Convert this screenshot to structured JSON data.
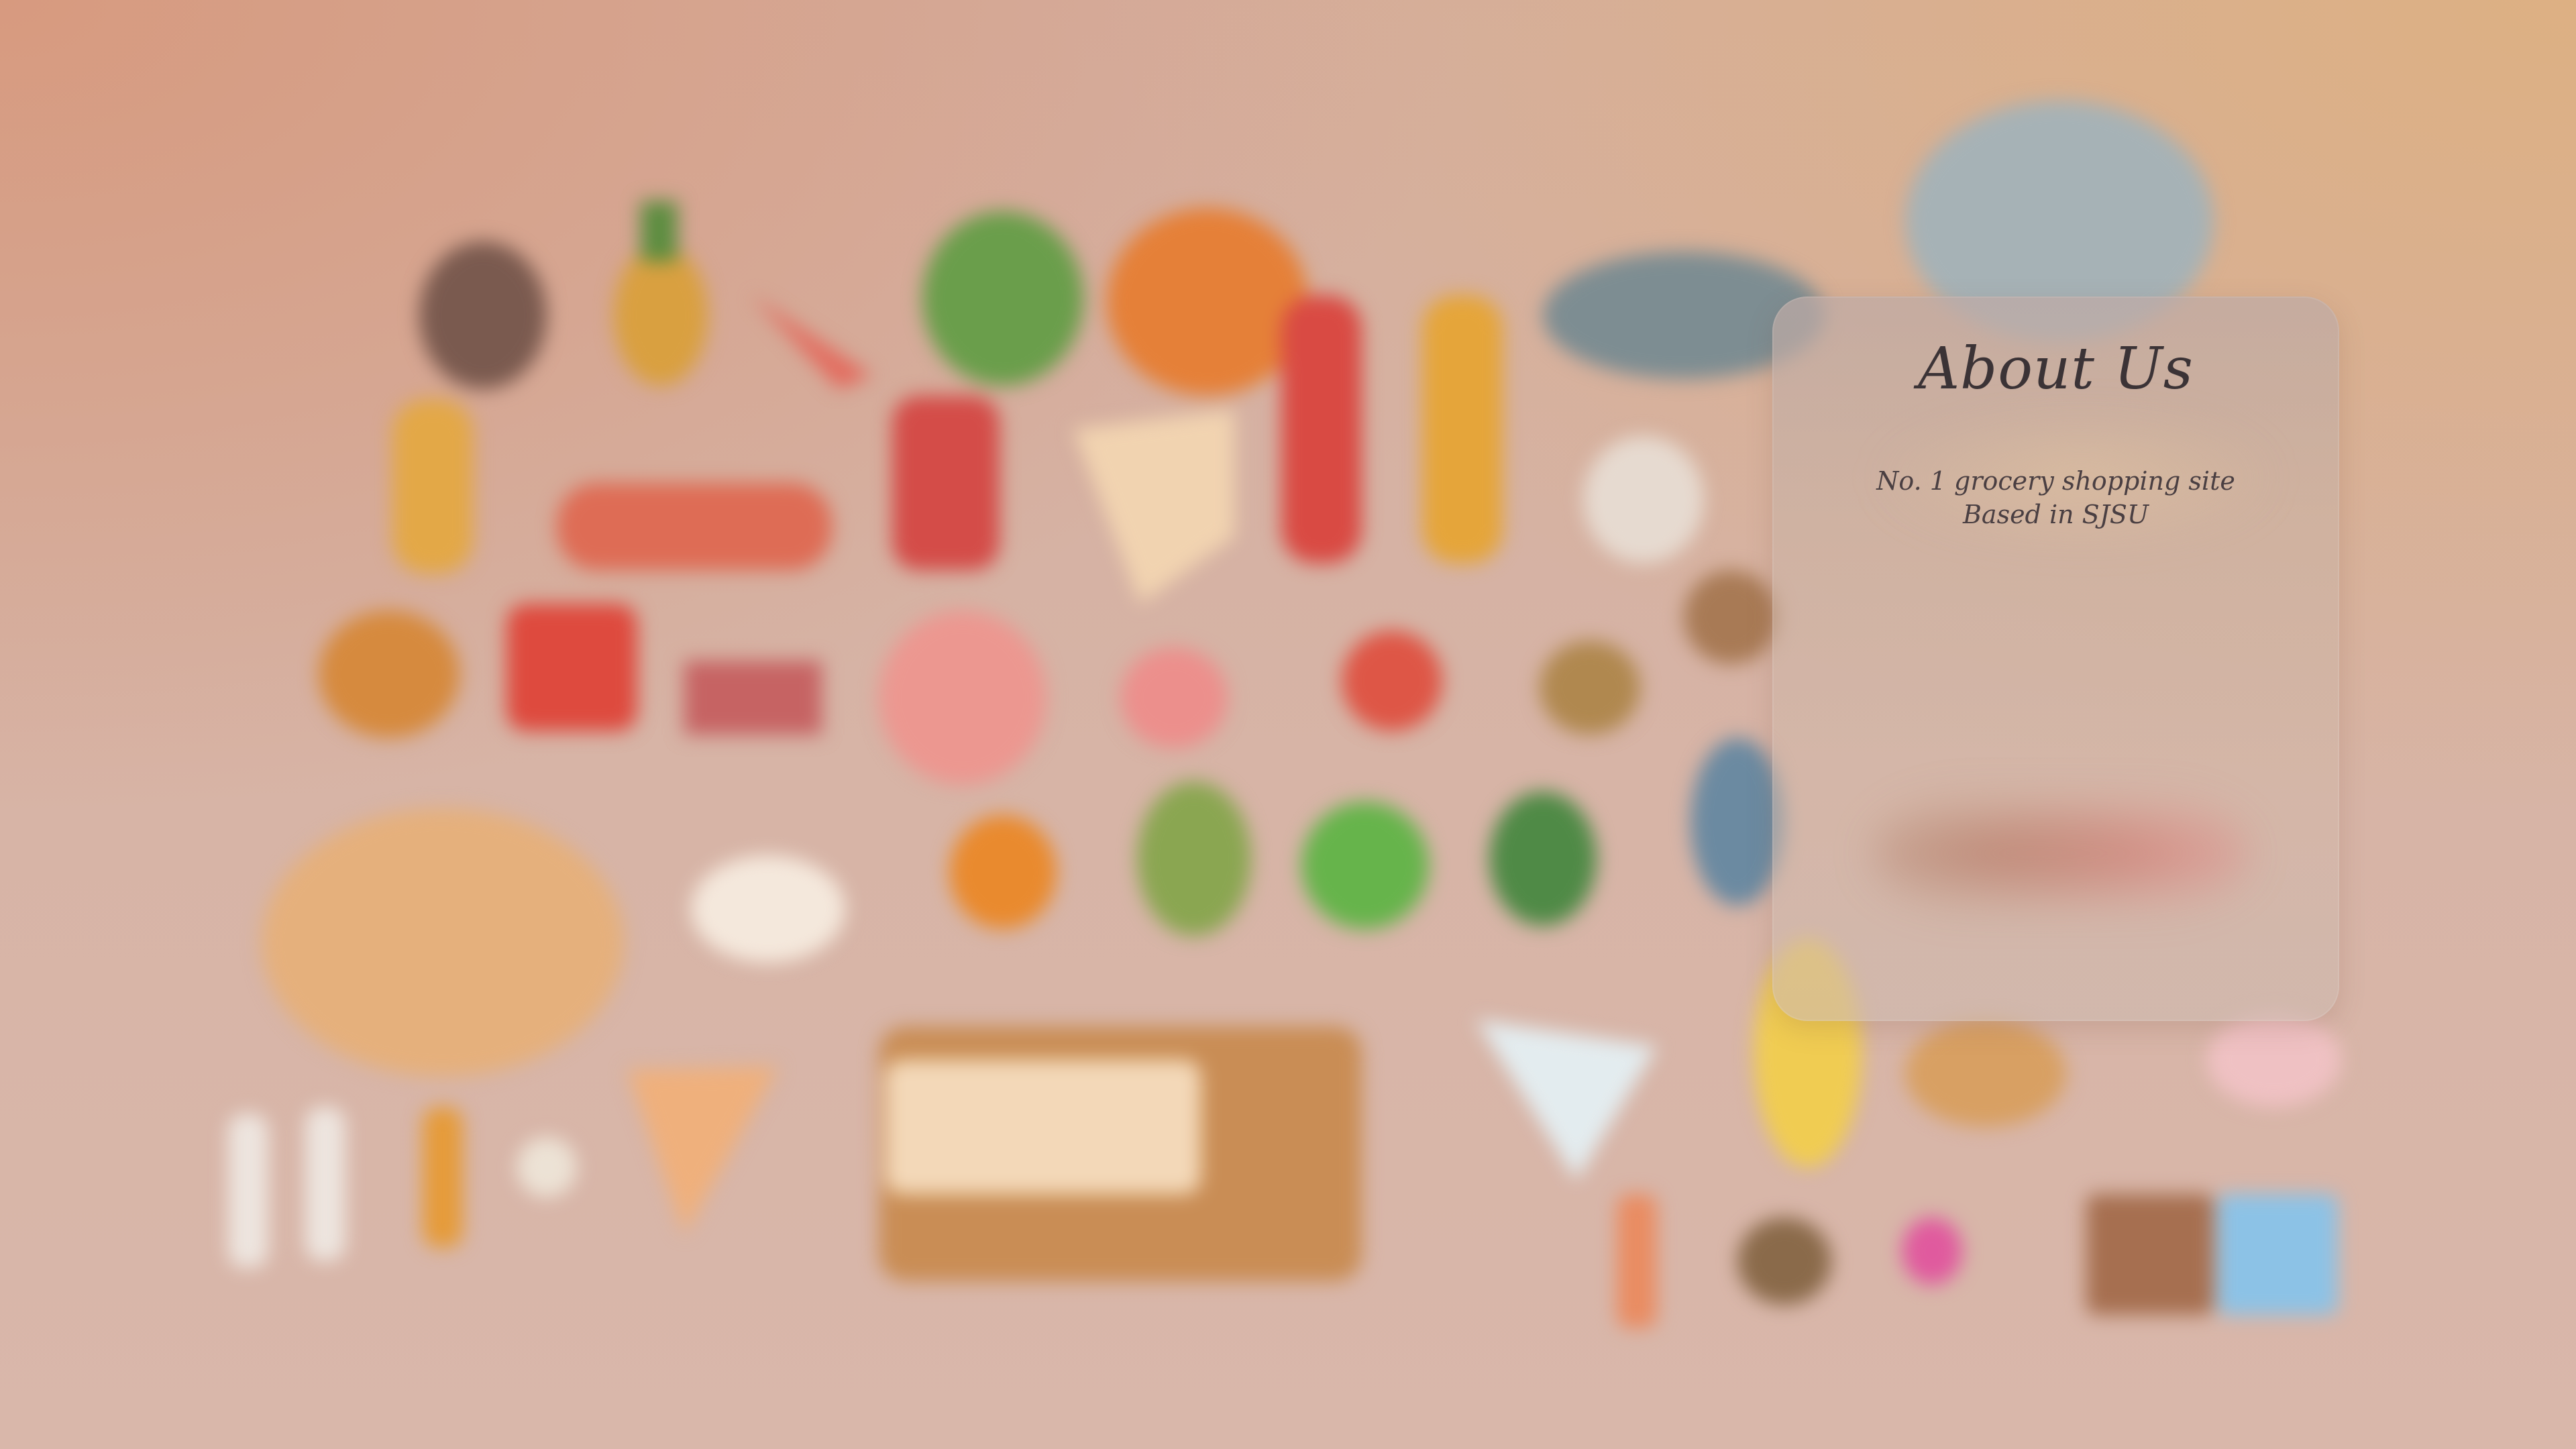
{
  "about": {
    "title": "About Us",
    "lines": [
      "No. 1 grocery shopping site",
      "Based in SJSU"
    ]
  },
  "colors": {
    "background_top_left": "#d79a7f",
    "background_main": "#d6b2a4",
    "card_tint": "#bfaaa5",
    "title_text": "#3b3336"
  },
  "background_illustration": "blurred assortment of 3D food items and kitchen utensils"
}
